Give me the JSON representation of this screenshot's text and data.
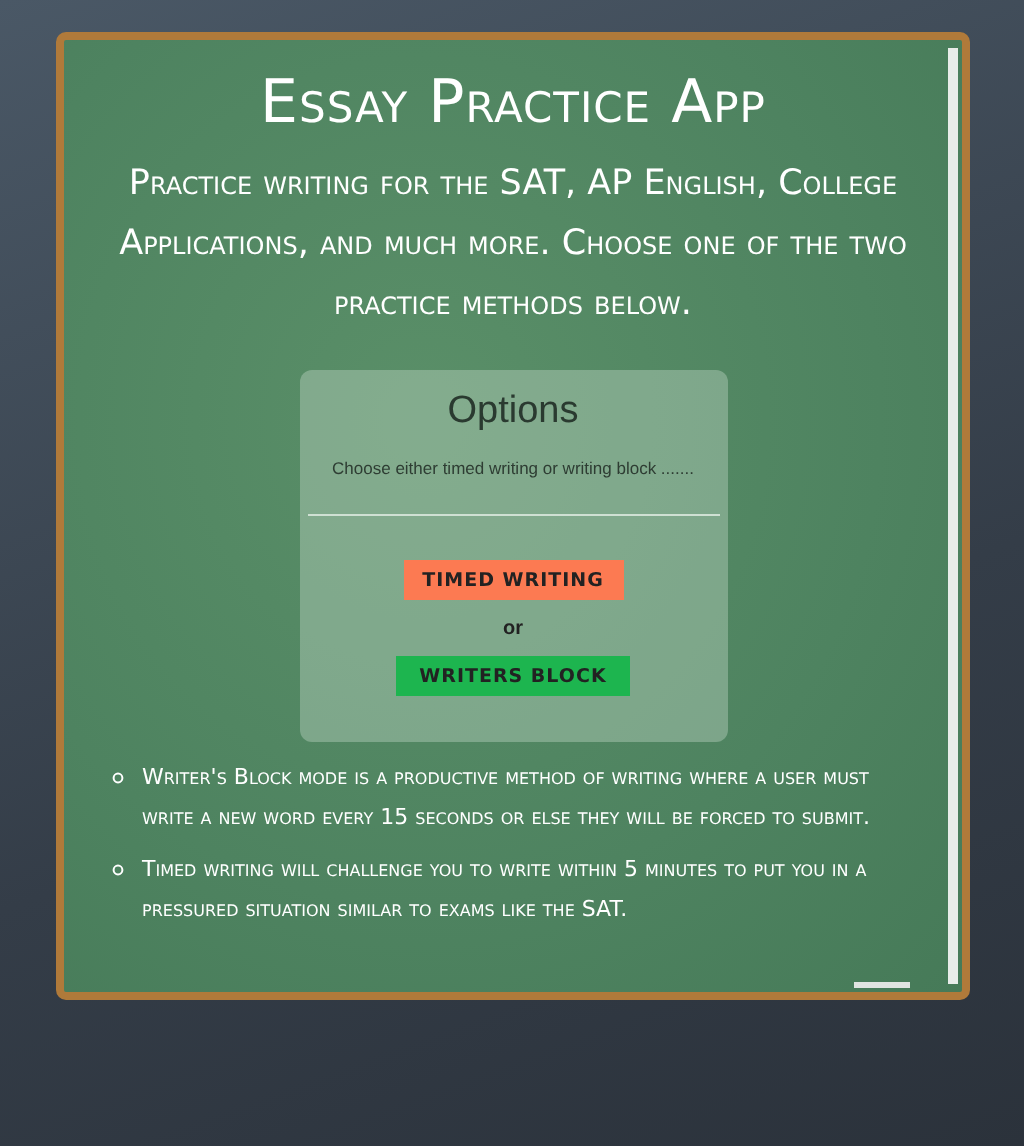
{
  "header": {
    "title": "Essay Practice App",
    "subtitle": "Practice writing for the SAT, AP English, College Applications, and much more. Choose one of the two practice methods below."
  },
  "options": {
    "title": "Options",
    "description": "Choose either timed writing or writing block .......",
    "buttons": [
      {
        "label": "TIMED WRITING",
        "kind": "timed"
      },
      {
        "label": "WRITERS BLOCK",
        "kind": "block"
      }
    ],
    "separator": "or"
  },
  "notes": [
    "Writer's Block mode is a productive method of writing where a user must write a new word every 15 seconds or else they will be forced to submit.",
    "Timed writing will challenge you to write within 5 minutes to put you in a pressured situation similar to exams like the SAT."
  ]
}
